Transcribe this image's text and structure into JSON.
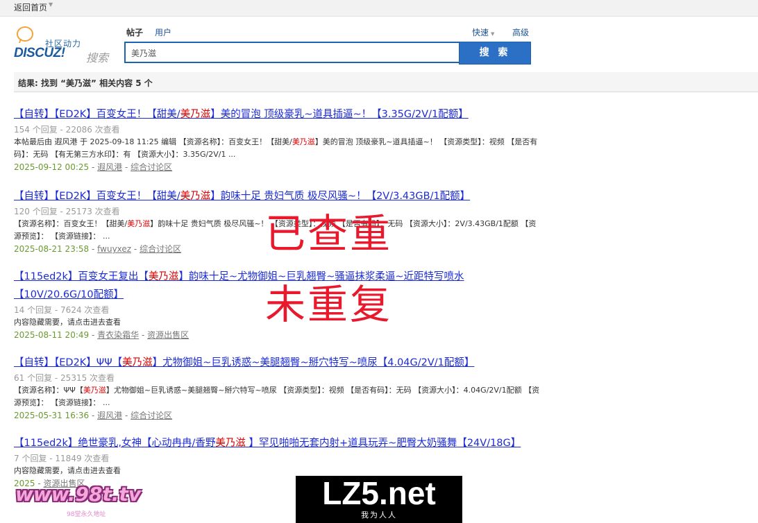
{
  "topbar": {
    "home": "返回首页"
  },
  "logo": {
    "community": "社区动力",
    "brand": "DISCUZ!",
    "search_word": "搜索"
  },
  "tabs": {
    "post": "帖子",
    "user": "用户"
  },
  "quick": "快速",
  "advanced": "高级",
  "search": {
    "value": "美乃滋",
    "button": "搜 索"
  },
  "summary": "结果: 找到 “美乃滋” 相关内容 5 个",
  "results": [
    {
      "title_before": "【自转】【ED2K】百变女王！【甜美/",
      "title_hl": "美乃滋",
      "title_after": "】美的冒泡 顶级豪乳~道具插逼~！【3.35G/2V/1配额】",
      "meta": "154 个回复 - 22086 次查看",
      "body_before": "本帖最后由 遐风港 于 2025-09-18 11:25 编辑 【资源名称】：百变女王！【甜美/",
      "body_hl": "美乃滋",
      "body_after": "】美的冒泡 顶级豪乳~道具插逼~！ 【资源类型】：视频 【是否有码】：无码 【有无第三方水印】：有 【资源大小】：3.35G/2V/1 ...",
      "date": "2025-09-12 00:25",
      "author": "遐风港",
      "forum": "综合讨论区"
    },
    {
      "title_before": "【自转】【ED2K】百变女王！【甜美/",
      "title_hl": "美乃滋",
      "title_after": "】韵味十足 贵妇气质 极尽风骚~！【2V/3.43GB/1配额】",
      "meta": "120 个回复 - 25173 次查看",
      "body_before": "【资源名称】：百变女王！【甜美/",
      "body_hl": "美乃滋",
      "body_after": "】韵味十足 贵妇气质 极尽风骚~！ 【资源类型】：视频 【是否有码】：无码 【资源大小】：2V/3.43GB/1配额 【资源预览】： 【资源链接】： ...",
      "date": "2025-08-21 23:58",
      "author": "fwuyxez",
      "forum": "综合讨论区"
    },
    {
      "title_before": "【115ed2k】百变女王复出【",
      "title_hl": "美乃滋",
      "title_after": "】韵味十足~尤物御姐~巨乳翘臀~骚逼抹浆柔逼~近距特写喷水【10V/20.6G/10配额】",
      "meta": "14 个回复 - 7624 次查看",
      "body_before": "内容隐藏需要，请点击进去查看",
      "body_hl": "",
      "body_after": "",
      "date": "2025-08-11 20:49",
      "author": "青衣染霜华",
      "forum": "资源出售区"
    },
    {
      "title_before": "【自转】【ED2K】ΨΨ【",
      "title_hl": "美乃滋",
      "title_after": "】尤物御姐~巨乳诱惑~美腿翘臀~掰穴特写~喷尿【4.04G/2V/1配额】",
      "meta": "61 个回复 - 25315 次查看",
      "body_before": "【资源名称】：ΨΨ【",
      "body_hl": "美乃滋",
      "body_after": "】尤物御姐~巨乳诱惑~美腿翘臀~掰穴特写~喷尿 【资源类型】：视频 【是否有码】：无码 【资源大小】：4.04G/2V/1配额 【资源预览】： 【资源链接】： ...",
      "date": "2025-05-31 16:36",
      "author": "遐风港",
      "forum": "综合讨论区"
    },
    {
      "title_before": "【115ed2k】绝世豪乳,女神【心动冉冉/香野",
      "title_hl": "美乃滋",
      "title_after": " 】罕见啪啪无套内射+道具玩弄~肥臀大奶骚舞【24V/18G】",
      "meta": "7 个回复 - 11849 次查看",
      "body_before": "内容隐藏需要，请点击进去查看",
      "body_hl": "",
      "body_after": "",
      "date": "2025",
      "author": "",
      "forum": "资源出售区"
    }
  ],
  "stamps": {
    "line1": "已查重",
    "line2": "未重复"
  },
  "watermarks": {
    "lz5_big": "LZ5.net",
    "lz5_small": "我为人人",
    "site_big": "www.98t.tv",
    "site_small": "98堂永久地址"
  },
  "colors": {
    "link": "#1b2bd6",
    "highlight": "#e00000",
    "date": "#6a9a30",
    "search_button": "#2b70c5",
    "stamp": "#e8192c"
  }
}
